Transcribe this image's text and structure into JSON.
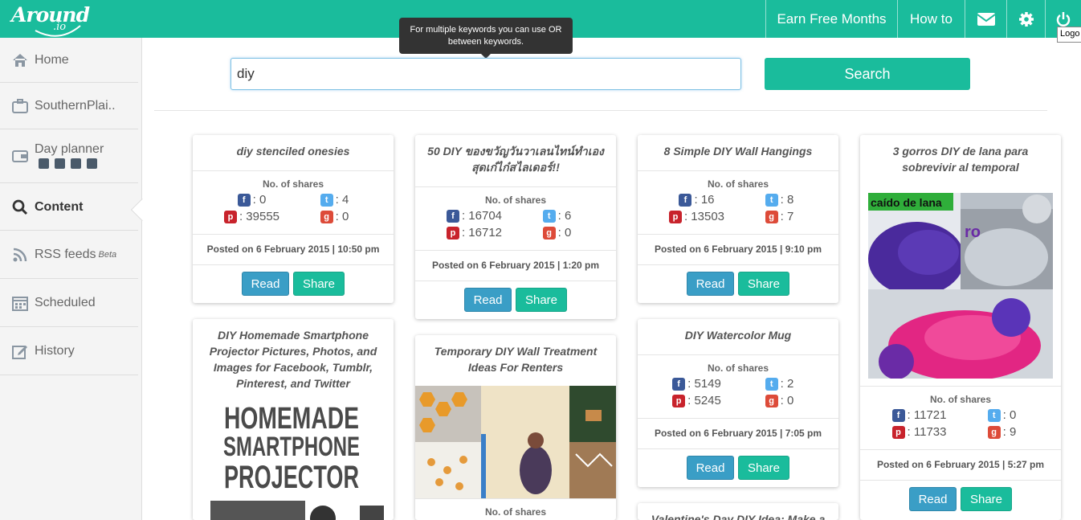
{
  "header": {
    "logo_main": "Around",
    "logo_sub": ".io",
    "nav": [
      "Earn Free Months",
      "How to"
    ],
    "logout_tooltip": "Logo"
  },
  "sidebar": {
    "items": [
      {
        "label": "Home",
        "icon": "home-icon"
      },
      {
        "label": "SouthernPlai..",
        "icon": "briefcase-icon"
      },
      {
        "label": "Day planner",
        "icon": "wallet-icon"
      },
      {
        "label": "Content",
        "icon": "search-icon"
      },
      {
        "label": "RSS feeds",
        "sup": "Beta",
        "icon": "rss-icon"
      },
      {
        "label": "Scheduled",
        "icon": "calendar-icon"
      },
      {
        "label": "History",
        "icon": "edit-icon"
      }
    ]
  },
  "search": {
    "value": "diy",
    "tooltip": "For multiple keywords you can use OR between keywords.",
    "button": "Search"
  },
  "labels": {
    "shares": "No. of shares",
    "read": "Read",
    "share": "Share"
  },
  "cards": [
    {
      "title": "diy stenciled onesies",
      "fb": ": 0",
      "tw": ": 4",
      "pi": ": 39555",
      "gp": ": 0",
      "posted": "Posted on 6 February 2015 | 10:50 pm"
    },
    {
      "title": "50 DIY ของขวัญวันวาเลนไทน์ทำเอง สุดเก๋ไก๋สไลเดอร์!!",
      "fb": ": 16704",
      "tw": ": 6",
      "pi": ": 16712",
      "gp": ": 0",
      "posted": "Posted on 6 February 2015 | 1:20 pm"
    },
    {
      "title": "8 Simple DIY Wall Hangings",
      "fb": ": 16",
      "tw": ": 8",
      "pi": ": 13503",
      "gp": ": 7",
      "posted": "Posted on 6 February 2015 | 9:10 pm"
    },
    {
      "title": "3 gorros DIY de lana para sobrevivir al temporal",
      "img_text1": "caído de lana",
      "img_text2": "ro",
      "fb": ": 11721",
      "tw": ": 0",
      "pi": ": 11733",
      "gp": ": 9",
      "posted": "Posted on 6 February 2015 | 5:27 pm"
    },
    {
      "title": "DIY Homemade Smartphone Projector Pictures, Photos, and Images for Facebook, Tumblr, Pinterest, and Twitter",
      "img_text": [
        "HOMEMADE",
        "SMARTPHONE",
        "PROJECTOR"
      ]
    },
    {
      "title": "Temporary DIY Wall Treatment Ideas For Renters"
    },
    {
      "title": "DIY Watercolor Mug",
      "fb": ": 5149",
      "tw": ": 2",
      "pi": ": 5245",
      "gp": ": 0",
      "posted": "Posted on 6 February 2015 | 7:05 pm"
    },
    {
      "title": "Valentine's Day DIY Idea: Make a"
    }
  ]
}
